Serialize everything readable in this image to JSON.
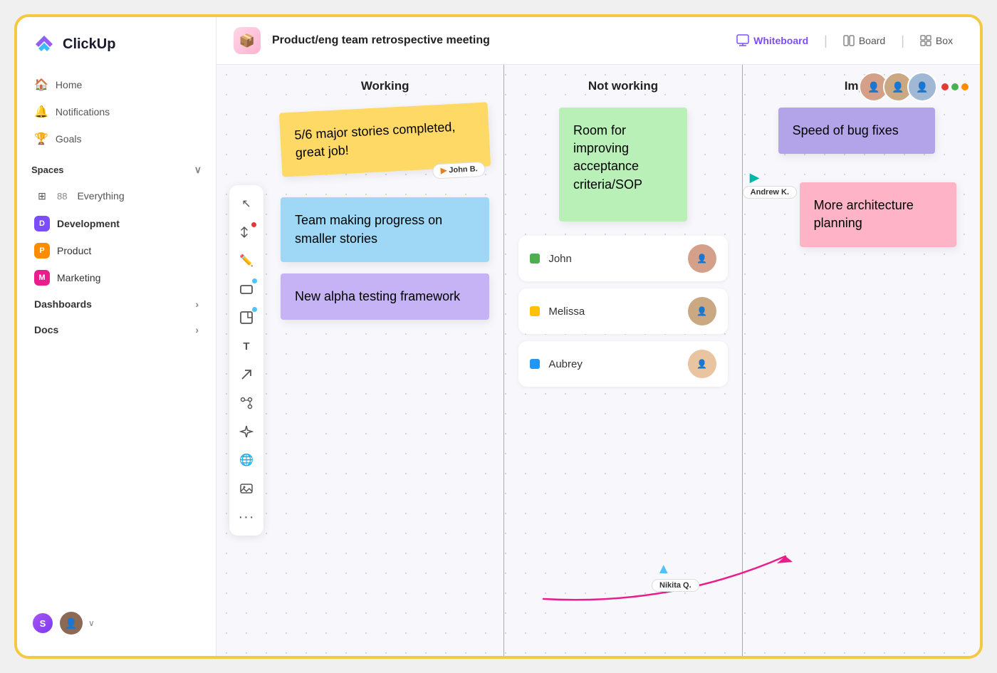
{
  "app": {
    "name": "ClickUp"
  },
  "sidebar": {
    "nav_items": [
      {
        "id": "home",
        "label": "Home",
        "icon": "🏠"
      },
      {
        "id": "notifications",
        "label": "Notifications",
        "icon": "🔔"
      },
      {
        "id": "goals",
        "label": "Goals",
        "icon": "🏆"
      }
    ],
    "spaces_label": "Spaces",
    "everything_label": "Everything",
    "everything_count": "88",
    "spaces": [
      {
        "id": "development",
        "label": "Development",
        "badge": "D",
        "color": "purple",
        "active": true
      },
      {
        "id": "product",
        "label": "Product",
        "badge": "P",
        "color": "orange"
      },
      {
        "id": "marketing",
        "label": "Marketing",
        "badge": "M",
        "color": "pink"
      }
    ],
    "dashboards_label": "Dashboards",
    "docs_label": "Docs"
  },
  "topbar": {
    "meeting_title": "Product/eng team retrospective meeting",
    "views": [
      {
        "id": "whiteboard",
        "label": "Whiteboard",
        "active": true
      },
      {
        "id": "board",
        "label": "Board",
        "active": false
      },
      {
        "id": "box",
        "label": "Box",
        "active": false
      }
    ]
  },
  "columns": [
    {
      "id": "working",
      "label": "Working"
    },
    {
      "id": "not_working",
      "label": "Not working"
    },
    {
      "id": "improve",
      "label": "Improve"
    }
  ],
  "sticky_notes": {
    "working": [
      {
        "id": "w1",
        "text": "5/6 major stories completed, great job!",
        "color": "yellow",
        "cursor_label": "John B."
      },
      {
        "id": "w2",
        "text": "Team making progress on smaller stories",
        "color": "blue"
      },
      {
        "id": "w3",
        "text": "New alpha testing framework",
        "color": "purple"
      }
    ],
    "not_working": [
      {
        "id": "n1",
        "text": "Room for improving acceptance criteria/SOP",
        "color": "green"
      }
    ],
    "improve": [
      {
        "id": "i1",
        "text": "Speed of bug fixes",
        "color": "purple"
      },
      {
        "id": "i2",
        "text": "More architecture planning",
        "color": "pink"
      }
    ]
  },
  "members": [
    {
      "id": "john",
      "name": "John",
      "dot_color": "#4caf50"
    },
    {
      "id": "melissa",
      "name": "Melissa",
      "dot_color": "#ffc107"
    },
    {
      "id": "aubrey",
      "name": "Aubrey",
      "dot_color": "#2196f3"
    }
  ],
  "cursors": [
    {
      "id": "andrew",
      "label": "Andrew K."
    },
    {
      "id": "nikita",
      "label": "Nikita Q."
    }
  ],
  "toolbar": {
    "tools": [
      {
        "id": "select",
        "icon": "↖",
        "dot": null
      },
      {
        "id": "move",
        "icon": "⤢",
        "dot": "#e53935"
      },
      {
        "id": "pen",
        "icon": "✏️",
        "dot": null
      },
      {
        "id": "rect",
        "icon": "▭",
        "dot": "#4fc3f7"
      },
      {
        "id": "sticky",
        "icon": "🗒",
        "dot": "#4fc3f7"
      },
      {
        "id": "text",
        "icon": "T",
        "dot": null
      },
      {
        "id": "arrow",
        "icon": "↗",
        "dot": null
      },
      {
        "id": "connect",
        "icon": "⬡",
        "dot": null
      },
      {
        "id": "star",
        "icon": "✦",
        "dot": null
      },
      {
        "id": "globe",
        "icon": "🌐",
        "dot": null
      },
      {
        "id": "image",
        "icon": "🖼",
        "dot": null
      },
      {
        "id": "more",
        "icon": "⋯",
        "dot": null
      }
    ]
  }
}
